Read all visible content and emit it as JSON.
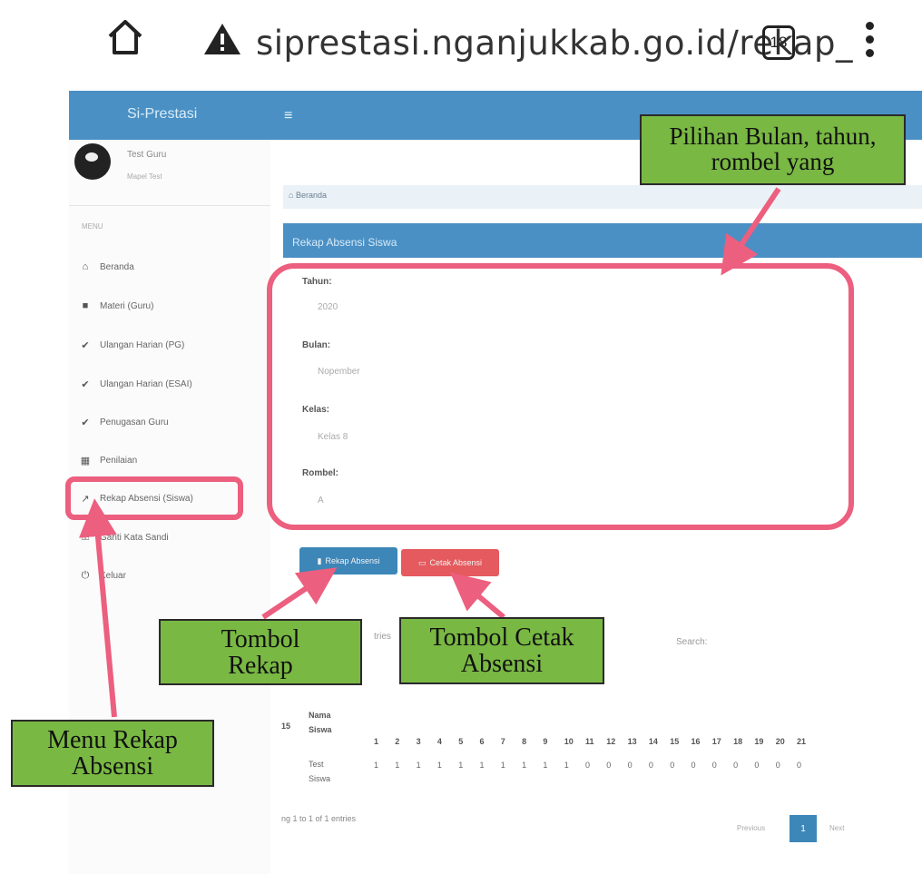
{
  "browser": {
    "url": "siprestasi.nganjukkab.go.id/rekap_",
    "tab_count": "18"
  },
  "app": {
    "brand": "Si-Prestasi",
    "menu_icon": "≡"
  },
  "user": {
    "name": "Test Guru",
    "role": "Mapel Test"
  },
  "sidebar": {
    "title": "MENU",
    "items": [
      {
        "label": "Beranda",
        "icon": "home-icon"
      },
      {
        "label": "Materi (Guru)",
        "icon": "folder-icon"
      },
      {
        "label": "Ulangan Harian (PG)",
        "icon": "check-icon"
      },
      {
        "label": "Ulangan Harian (ESAI)",
        "icon": "check-icon"
      },
      {
        "label": "Penugasan Guru",
        "icon": "check-icon"
      },
      {
        "label": "Penilaian",
        "icon": "calendar-icon"
      },
      {
        "label": "Rekap Absensi (Siswa)",
        "icon": "chart-line-icon"
      },
      {
        "label": "Ganti Kata Sandi",
        "icon": "key-icon"
      },
      {
        "label": "Keluar",
        "icon": "power-icon"
      }
    ]
  },
  "breadcrumb": "Beranda",
  "panel": {
    "title": "Rekap Absensi Siswa",
    "fields": [
      {
        "label": "Tahun:",
        "value": "2020"
      },
      {
        "label": "Bulan:",
        "value": "Nopember"
      },
      {
        "label": "Kelas:",
        "value": "Kelas 8"
      },
      {
        "label": "Rombel:",
        "value": "A"
      }
    ],
    "btn_rekap": "Rekap Absensi",
    "btn_cetak": "Cetak Absensi"
  },
  "table_controls": {
    "entries_tail": "tries",
    "search_label": "Search:"
  },
  "table": {
    "col_no": "15",
    "col_name": "Nama Siswa",
    "days": [
      "1",
      "2",
      "3",
      "4",
      "5",
      "6",
      "7",
      "8",
      "9",
      "10",
      "11",
      "12",
      "13",
      "14",
      "15",
      "16",
      "17",
      "18",
      "19",
      "20",
      "21"
    ],
    "row": {
      "name": "Test Siswa",
      "values": [
        "1",
        "1",
        "1",
        "1",
        "1",
        "1",
        "1",
        "1",
        "1",
        "1",
        "0",
        "0",
        "0",
        "0",
        "0",
        "0",
        "0",
        "0",
        "0",
        "0",
        "0"
      ]
    }
  },
  "table_info": "ng 1 to 1 of 1 entries",
  "pagination": {
    "previous": "Previous",
    "current": "1",
    "next": "Next"
  },
  "annotations": {
    "pilihan": "Pilihan Bulan, tahun, rombel yang",
    "tombol_rekap": "Tombol Rekap",
    "tombol_cetak": "Tombol Cetak Absensi",
    "menu_rekap": "Menu Rekap Absensi"
  },
  "colors": {
    "header_blue": "#4a90c4",
    "highlight_pink": "#ec5f7f",
    "callout_green": "#79b843",
    "danger_red": "#e45a5e"
  }
}
